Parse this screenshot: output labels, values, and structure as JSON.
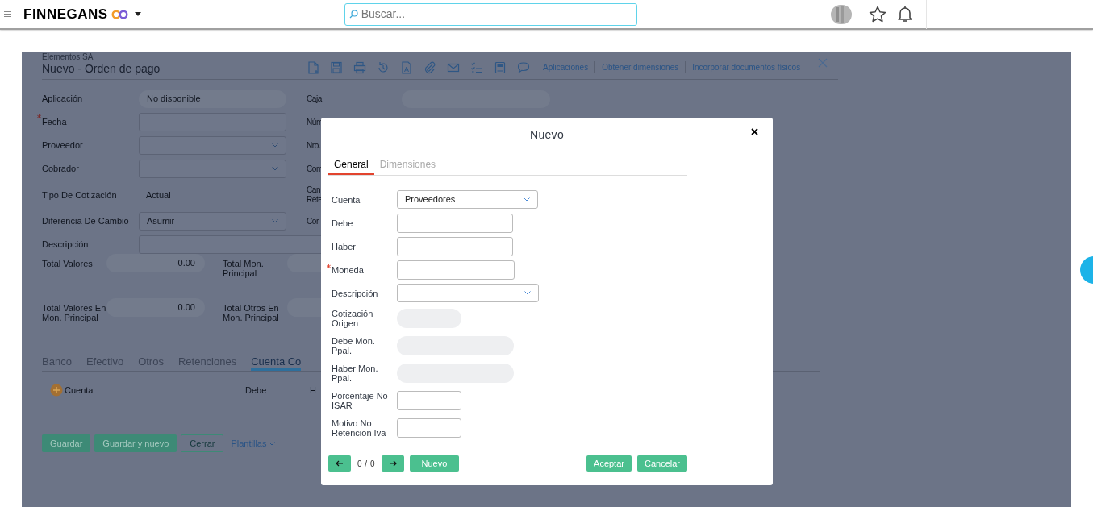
{
  "header": {
    "brand": "FINNEGANS",
    "search": {
      "placeholder": "Buscar..."
    }
  },
  "page": {
    "company": "Elementos SA",
    "title": "Nuevo - Orden de pago",
    "actions": [
      "Aplicaciones",
      "Obtener dimensiones",
      "Incorporar documentos físicos"
    ],
    "form_rows": [
      {
        "label": "Aplicación",
        "kind": "readonly",
        "value": "No disponible",
        "right_label": "Caja",
        "right_field": true
      },
      {
        "label": "Fecha",
        "required": true,
        "kind": "input",
        "right_label": "Núm"
      },
      {
        "label": "Proveedor",
        "kind": "select",
        "right_label": "Nro."
      },
      {
        "label": "Cobrador",
        "kind": "select",
        "right_label": "Com"
      },
      {
        "label": "Tipo De Cotización",
        "kind": "text",
        "value": "Actual",
        "right_label": "Can Rete"
      },
      {
        "label": "Diferencia De Cambio",
        "kind": "select",
        "value": "Asumir",
        "right_label": "Cor"
      },
      {
        "label": "Descripción",
        "kind": "wide"
      }
    ],
    "totals": [
      {
        "label": "Total Valores",
        "value": "0.00",
        "label_2": "Total Mon. Principal"
      },
      {
        "label": "Total Valores En Mon. Principal",
        "value": "0.00",
        "label_2": "Total Otros En Mon. Principal"
      }
    ],
    "tabs": [
      {
        "label": "Banco",
        "selected": false
      },
      {
        "label": "Efectivo",
        "selected": false
      },
      {
        "label": "Otros",
        "selected": false
      },
      {
        "label": "Retenciones",
        "selected": false
      },
      {
        "label": "Cuenta Co",
        "selected": true
      }
    ],
    "table": {
      "columns": [
        "Cuenta",
        "Debe",
        "H"
      ]
    },
    "buttons": [
      {
        "label": "Guardar",
        "kind": "primary"
      },
      {
        "label": "Guardar y nuevo",
        "kind": "primary"
      },
      {
        "label": "Cerrar",
        "kind": "outline"
      },
      {
        "label": "Plantillas",
        "kind": "link"
      }
    ]
  },
  "dialog": {
    "title": "Nuevo",
    "tabs": [
      {
        "label": "General",
        "selected": true
      },
      {
        "label": "Dimensiones",
        "selected": false
      }
    ],
    "fields": [
      {
        "label": "Cuenta",
        "kind": "select",
        "value": "Proveedores",
        "required": false
      },
      {
        "label": "Debe",
        "kind": "input",
        "required": false
      },
      {
        "label": "Haber",
        "kind": "input",
        "required": false
      },
      {
        "label": "Moneda",
        "kind": "input",
        "required": true
      },
      {
        "label": "Descripción",
        "kind": "select",
        "required": false
      },
      {
        "label": "Cotización Origen",
        "kind": "readonly",
        "required": false
      },
      {
        "label": "Debe Mon. Ppal.",
        "kind": "readonly",
        "required": false
      },
      {
        "label": "Haber Mon. Ppal.",
        "kind": "readonly",
        "required": false
      },
      {
        "label": "Porcentaje No ISAR",
        "kind": "input",
        "required": false
      },
      {
        "label": "Motivo No Retencion Iva",
        "kind": "input",
        "required": false
      }
    ],
    "pager": "0 / 0",
    "buttons": [
      {
        "label": "Nuevo",
        "kind": "left"
      },
      {
        "label": "Aceptar",
        "kind": "right"
      },
      {
        "label": "Cancelar",
        "kind": "right"
      }
    ]
  }
}
